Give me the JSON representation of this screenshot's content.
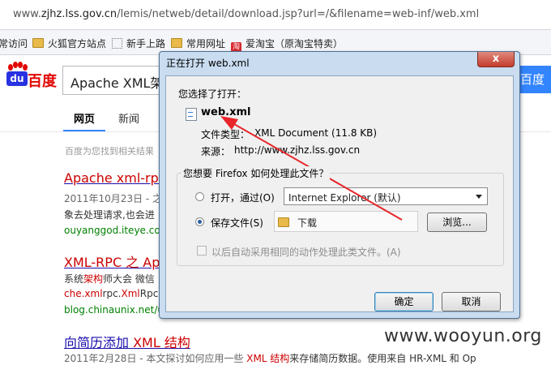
{
  "browser": {
    "url_prefix": "www.",
    "url_host": "zjhz.lss.gov.cn",
    "url_path": "/lemis/netweb/detail/download.jsp?url=/&filename=web-inf/web.xml",
    "bookmarks": [
      {
        "label": "常访问",
        "icon": "none"
      },
      {
        "label": "火狐官方站点",
        "icon": "folder-icon"
      },
      {
        "label": "新手上路",
        "icon": "dotted-box-icon"
      },
      {
        "label": "常用网址",
        "icon": "folder-icon"
      },
      {
        "label": "爱淘宝（原淘宝特卖）",
        "icon": "taobao-icon"
      }
    ]
  },
  "baidu": {
    "logo_du": "du",
    "logo_text": "百度",
    "search_query": "Apache XML架",
    "search_button": "百度一",
    "tabs": [
      "网页",
      "新闻"
    ],
    "hint": "百度为您找到相关结果",
    "results": [
      {
        "title_pre": "",
        "title_em": "Apache xml-rpc",
        "title_post": "-",
        "desc1_date": "2011年10月23日 - 之",
        "desc2": "象去处理请求,也会进",
        "url": "ouyanggod.iteye.com/"
      },
      {
        "title_pre": "",
        "title_em": "XML-RPC 之 Ap",
        "title_post": "",
        "desc1_pre": "系统",
        "desc1_em": "架构",
        "desc1_post": "师大会 微信",
        "desc2_em1": "che.xml",
        "desc2_mid": "rpc.",
        "desc2_em2": "Xml",
        "desc2_post": "RpcS",
        "url": "blog.chinaunix.net/u"
      },
      {
        "title_pre": "向简历添加 ",
        "title_em": "XML 结构",
        "title_post": "",
        "desc1_date": "2011年2月28日 - 本文探讨如何应用一些 ",
        "desc1_em": "XML 结构",
        "desc1_post": "来存储简历数据。使用来自 HR-XML 和 Op"
      }
    ]
  },
  "dialog": {
    "title": "正在打开 web.xml",
    "close": "x",
    "you_chose": "您选择了打开：",
    "filename": "web.xml",
    "type_label": "文件类型：",
    "type_value": "XML Document (11.8 KB)",
    "source_label": "来源：",
    "source_value": "http://www.zjhz.lss.gov.cn",
    "question": "您想要 Firefox 如何处理此文件？",
    "open_with_label": "打开，通过(O)",
    "open_with_app": "Internet Explorer (默认)",
    "save_label": "保存文件(S)",
    "save_folder": "下载",
    "browse_button": "浏览...",
    "remember_label": "以后自动采用相同的动作处理此类文件。(A)",
    "ok_button": "确定",
    "cancel_button": "取消"
  },
  "watermark": "www.wooyun.org",
  "colors": {
    "arrow": "#e8262a",
    "link": "#1a0dab",
    "highlight": "#cc0000",
    "url_green": "#008000"
  }
}
